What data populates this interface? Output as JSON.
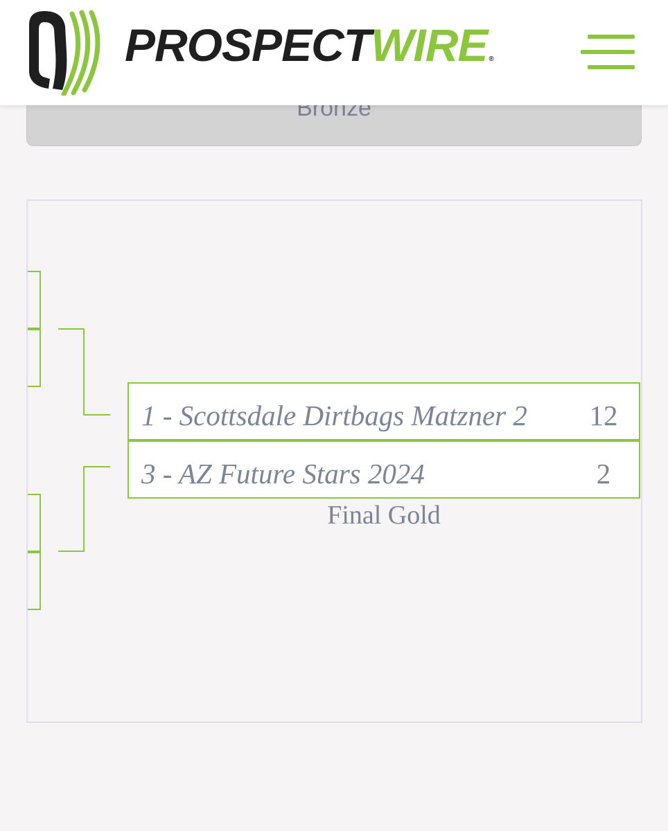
{
  "header": {
    "brand_part1": "PROSPECT",
    "brand_part2": "WIRE",
    "trademark": "®",
    "brand_color": "#8cc63f",
    "menu_icon": "hamburger-menu-icon"
  },
  "tabs": {
    "bronze_label": "Bronze"
  },
  "bracket": {
    "final": {
      "teams": [
        {
          "name": "1 - Scottsdale Dirtbags Matzner 2",
          "score": "12"
        },
        {
          "name": "3 - AZ Future Stars 2024",
          "score": "2"
        }
      ],
      "round_label": "Final Gold"
    },
    "line_color": "#8cc63f"
  }
}
